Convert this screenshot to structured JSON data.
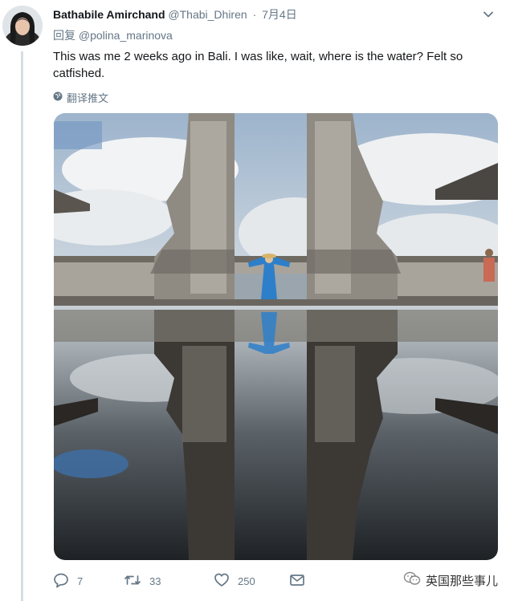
{
  "tweet": {
    "author_name": "Bathabile Amirchand",
    "handle": "@Thabi_Dhiren",
    "separator": "·",
    "date": "7月4日",
    "reply_prefix": "回复",
    "reply_mention": "@polina_marinova",
    "text": "This was me 2 weeks ago in Bali. I was like, wait, where is the water? Felt so catfished.",
    "translate_label": "翻译推文",
    "actions": {
      "reply_count": "7",
      "retweet_count": "33",
      "like_count": "250"
    }
  },
  "icons": {
    "more": "chevron-down-icon",
    "translate": "globe-icon",
    "reply": "speech-bubble-icon",
    "retweet": "retweet-arrows-icon",
    "like": "heart-icon",
    "share": "envelope-icon",
    "watermark": "wechat-icon"
  },
  "watermark": {
    "text": "英国那些事儿"
  },
  "colors": {
    "text_primary": "#14171a",
    "text_secondary": "#657786",
    "thread_line": "#d6dde3"
  }
}
